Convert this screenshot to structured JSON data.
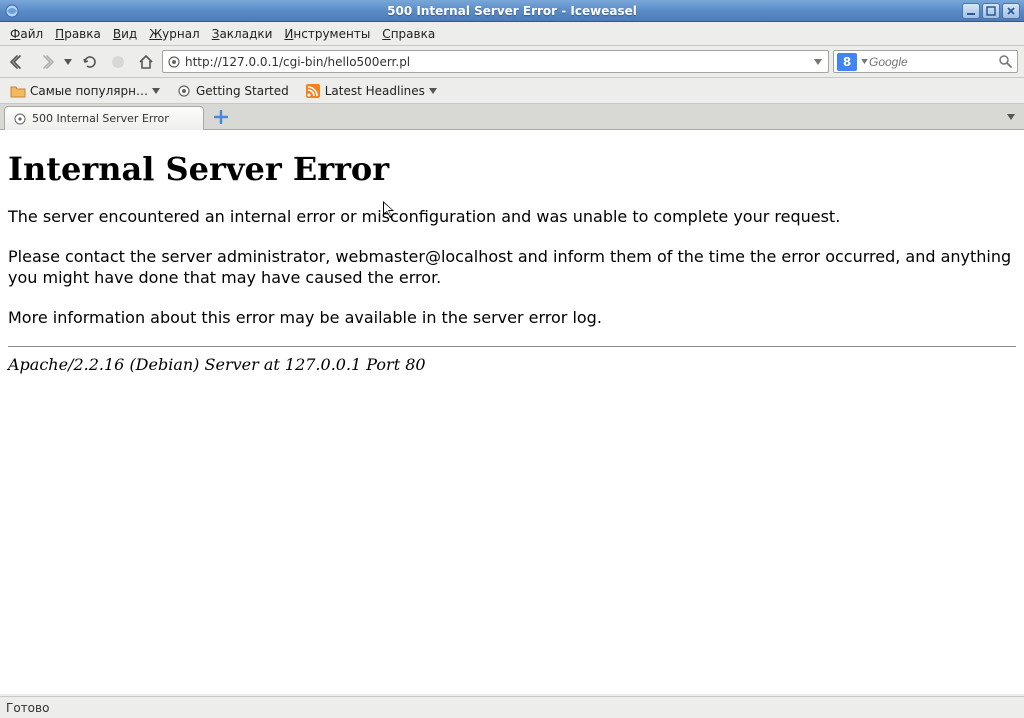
{
  "window": {
    "title": "500 Internal Server Error - Iceweasel"
  },
  "menu": {
    "items": [
      "Файл",
      "Правка",
      "Вид",
      "Журнал",
      "Закладки",
      "Инструменты",
      "Справка"
    ]
  },
  "nav": {
    "url": "http://127.0.0.1/cgi-bin/hello500err.pl",
    "search_placeholder": "Google",
    "search_engine_glyph": "8"
  },
  "bookmarks": {
    "items": [
      {
        "label": "Самые популярн…",
        "kind": "folder",
        "has_dropdown": true
      },
      {
        "label": "Getting Started",
        "kind": "page",
        "has_dropdown": false
      },
      {
        "label": "Latest Headlines",
        "kind": "feed",
        "has_dropdown": true
      }
    ]
  },
  "tabs": {
    "active": {
      "label": "500 Internal Server Error"
    }
  },
  "page": {
    "heading": "Internal Server Error",
    "p1": "The server encountered an internal error or misconfiguration and was unable to complete your request.",
    "p2": "Please contact the server administrator, webmaster@localhost and inform them of the time the error occurred, and anything you might have done that may have caused the error.",
    "p3": "More information about this error may be available in the server error log.",
    "server_sig": "Apache/2.2.16 (Debian) Server at 127.0.0.1 Port 80"
  },
  "status": {
    "text": "Готово"
  }
}
